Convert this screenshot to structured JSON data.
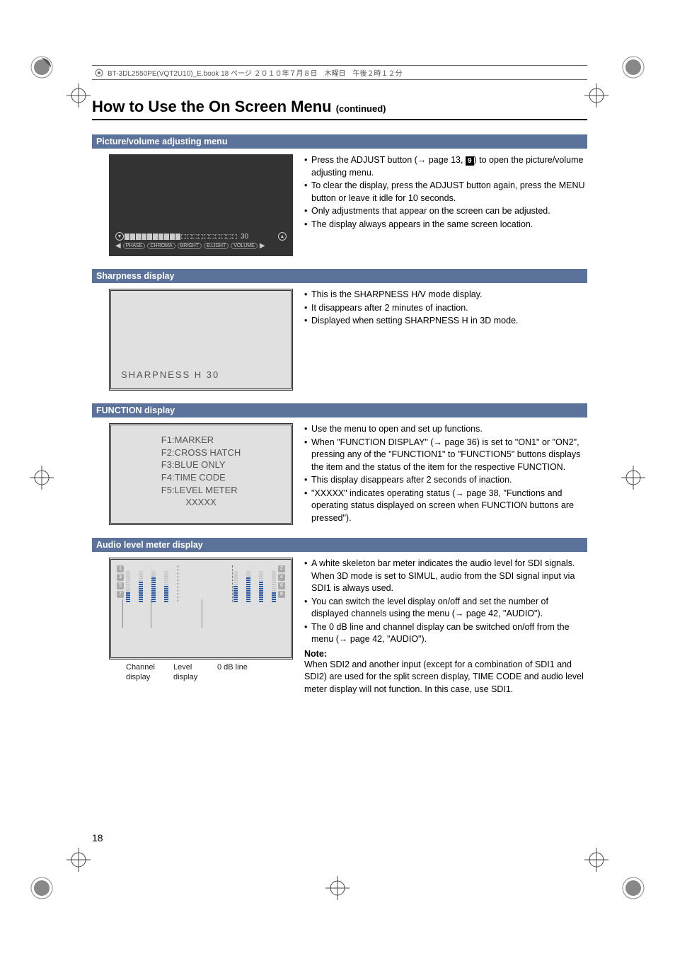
{
  "print_header": "BT-3DL2550PE(VQT2U10)_E.book  18 ページ  ２０１０年７月８日　木曜日　午後２時１２分",
  "title_main": "How to Use the On Screen Menu ",
  "title_cont": "(continued)",
  "page_number": "18",
  "sections": {
    "picture": {
      "heading": "Picture/volume adjusting menu",
      "bar_value": "30",
      "bar_labels": [
        "PHASE",
        "CHROMA",
        "BRIGHT",
        "B.LIGHT",
        "VOLUME"
      ],
      "bullets": [
        "Press the ADJUST button (→ page 13, [9]) to open the picture/volume adjusting menu.",
        "To clear the display, press the ADJUST button again, press the MENU button or leave it idle for 10 seconds.",
        "Only adjustments that appear on the screen can be adjusted.",
        "The display always appears in the same screen location."
      ],
      "ref_box": "9"
    },
    "sharpness": {
      "heading": "Sharpness display",
      "screen_text": "SHARPNESS   H   30",
      "bullets": [
        "This is the SHARPNESS H/V mode display.",
        "It disappears after 2 minutes of inaction.",
        "Displayed when setting SHARPNESS H in 3D mode."
      ]
    },
    "function": {
      "heading": "FUNCTION display",
      "lines": [
        "F1:MARKER",
        "F2:CROSS HATCH",
        "F3:BLUE ONLY",
        "F4:TIME CODE",
        "F5:LEVEL METER",
        "XXXXX"
      ],
      "bullets": [
        "Use the menu to open and set up functions.",
        "When \"FUNCTION DISPLAY\" (→ page 36) is set to \"ON1\" or \"ON2\", pressing any of the \"FUNCTION1\" to \"FUNCTION5\" buttons displays the item and the status of the item for the respective FUNCTION.",
        "This display disappears after 2 seconds of inaction.",
        "\"XXXXX\" indicates operating status (→ page 38, \"Functions and operating status displayed on screen when FUNCTION buttons are pressed\")."
      ]
    },
    "audio": {
      "heading": "Audio level meter display",
      "left_channels": [
        "1",
        "3",
        "5",
        "7"
      ],
      "right_channels": [
        "2",
        "4",
        "6",
        "8"
      ],
      "captions": {
        "channel": "Channel display",
        "level": "Level display",
        "db": "0 dB line"
      },
      "bullets": [
        "A white skeleton bar meter indicates the audio level for SDI signals. When 3D mode is set to SIMUL, audio from the SDI signal input via SDI1 is always used.",
        "You can switch the level display on/off and set the number of displayed channels using the menu (→ page 42, \"AUDIO\").",
        "The 0 dB line and channel display can be switched on/off from the menu (→ page 42, \"AUDIO\")."
      ],
      "note_label": "Note:",
      "note_text": "When SDI2 and another input (except for a combination of SDI1 and SDI2) are used for the split screen display, TIME CODE and audio level meter display will not function. In this case, use SDI1."
    }
  }
}
